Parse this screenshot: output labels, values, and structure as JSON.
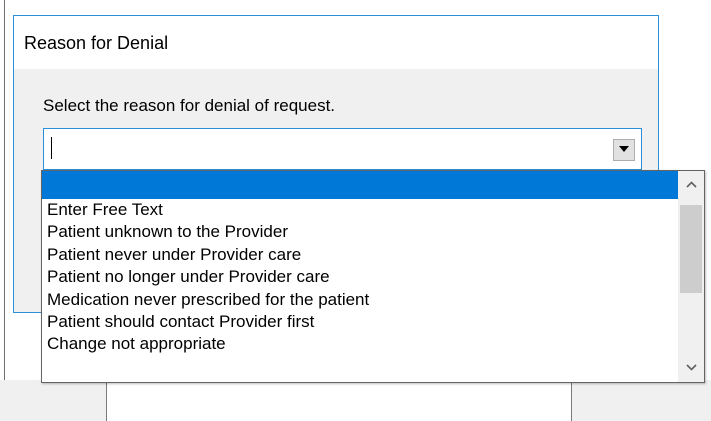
{
  "dialog": {
    "title": "Reason for Denial",
    "instruction": "Select the reason for denial of request.",
    "combo_value": ""
  },
  "dropdown": {
    "items": [
      "",
      "Enter Free Text",
      "Patient unknown to the Provider",
      "Patient never under Provider care",
      "Patient no longer under Provider care",
      "Medication never prescribed for the patient",
      "Patient should contact Provider first",
      "Change not appropriate"
    ],
    "selected_index": 0
  },
  "icons": {
    "combo_arrow": "chevron-down-icon",
    "scroll_up": "chevron-up-icon",
    "scroll_down": "chevron-down-icon"
  },
  "colors": {
    "accent": "#2b90d9",
    "selection": "#0078d7",
    "dialog_bg": "#f0f0f0"
  }
}
